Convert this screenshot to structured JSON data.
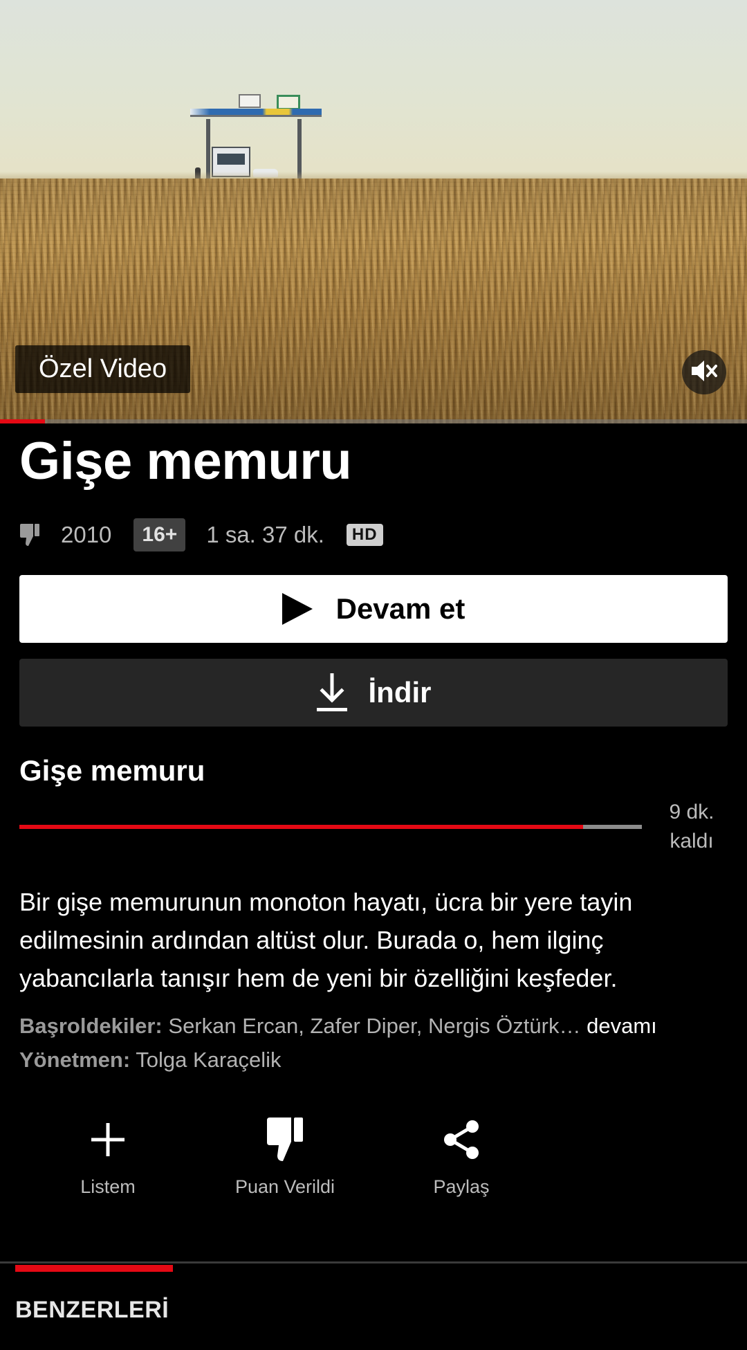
{
  "hero": {
    "badge_label": "Özel Video",
    "mute_icon": "volume-mute-icon",
    "playback_progress": 0.06
  },
  "title": {
    "main": "Gişe memuru",
    "rating_icon": "thumbs-down-icon",
    "year": "2010",
    "age_rating": "16+",
    "duration": "1 sa. 37 dk.",
    "quality": "HD"
  },
  "buttons": {
    "play_label": "Devam et",
    "play_icon": "play-icon",
    "download_label": "İndir",
    "download_icon": "download-icon"
  },
  "episode": {
    "title": "Gişe memuru",
    "progress": 0.905,
    "remaining_line1": "9 dk.",
    "remaining_line2": "kaldı"
  },
  "description": {
    "text": "Bir gişe memurunun monoton hayatı, ücra bir yere tayin edilmesinin ardından altüst olur. Burada o, hem ilginç yabancılarla tanışır hem de yeni bir özelliğini keşfeder.",
    "cast_label": "Başroldekiler:",
    "cast_value": "Serkan Ercan, Zafer Diper, Nergis Öztürk…",
    "cast_more": "devamı",
    "director_label": "Yönetmen:",
    "director_value": "Tolga Karaçelik"
  },
  "actions": [
    {
      "label": "Listem",
      "icon": "plus-icon"
    },
    {
      "label": "Puan Verildi",
      "icon": "thumbs-down-icon"
    },
    {
      "label": "Paylaş",
      "icon": "share-icon"
    }
  ],
  "tabs": [
    {
      "label": "BENZERLERİ",
      "active": true
    }
  ],
  "colors": {
    "accent": "#e50914",
    "background": "#000000",
    "secondary_button": "#262626"
  }
}
